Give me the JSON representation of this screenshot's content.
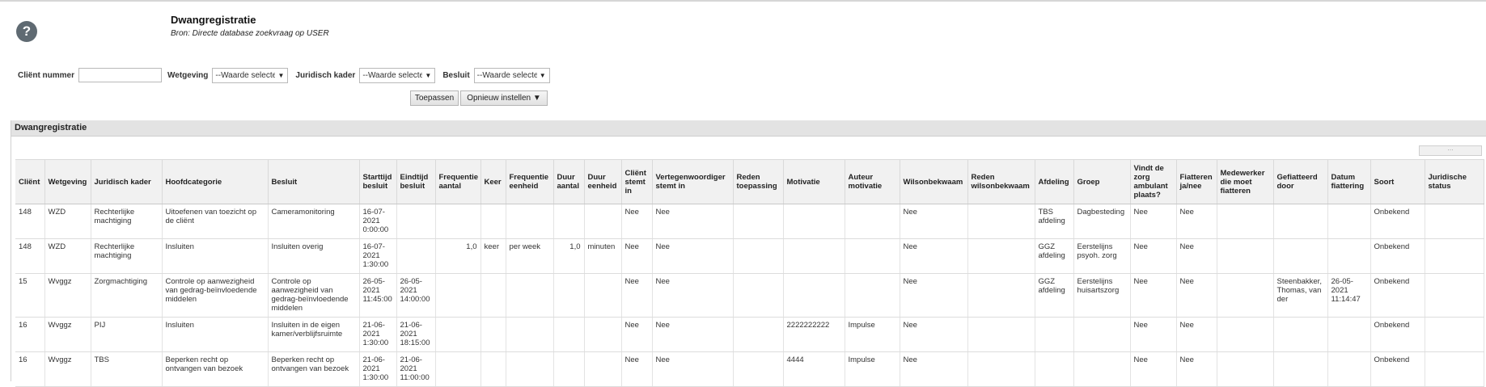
{
  "header": {
    "help_icon": "?",
    "title": "Dwangregistratie",
    "subtitle": "Bron: Directe database zoekvraag op USER"
  },
  "filters": {
    "client_label": "Cliënt nummer",
    "client_value": "",
    "wetgeving_label": "Wetgeving",
    "wetgeving_value": "--Waarde selecteren--",
    "juridisch_label": "Juridisch kader",
    "juridisch_value": "--Waarde selecteren--",
    "besluit_label": "Besluit",
    "besluit_value": "--Waarde selecteren--",
    "apply_label": "Toepassen",
    "reset_label": "Opnieuw instellen ▼"
  },
  "panel": {
    "title": "Dwangregistratie",
    "mini_control": "⋯"
  },
  "table": {
    "columns": [
      "Cliënt",
      "Wetgeving",
      "Juridisch kader",
      "Hoofdcategorie",
      "Besluit",
      "Starttijd besluit",
      "Eindtijd besluit",
      "Frequentie aantal",
      "Keer",
      "Frequentie eenheid",
      "Duur aantal",
      "Duur eenheid",
      "Cliënt stemt in",
      "Vertegenwoordiger stemt in",
      "Reden toepassing",
      "Motivatie",
      "Auteur motivatie",
      "Wilsonbekwaam",
      "Reden wilsonbekwaam",
      "Afdeling",
      "Groep",
      "Vindt de zorg ambulant plaats?",
      "Fiatteren ja/nee",
      "Medewerker die moet fiatteren",
      "Gefiatteerd door",
      "Datum fiattering",
      "Soort",
      "Juridische status"
    ],
    "rows": [
      [
        "148",
        "WZD",
        "Rechterlijke machtiging",
        "Uitoefenen van toezicht op de cliënt",
        "Cameramonitoring",
        "16-07-2021 0:00:00",
        "",
        "",
        "",
        "",
        "",
        "",
        "Nee",
        "Nee",
        "",
        "",
        "",
        "Nee",
        "",
        "TBS afdeling",
        "Dagbesteding",
        "Nee",
        "Nee",
        "",
        "",
        "",
        "Onbekend",
        ""
      ],
      [
        "148",
        "WZD",
        "Rechterlijke machtiging",
        "Insluiten",
        "Insluiten overig",
        "16-07-2021 1:30:00",
        "",
        "1,0",
        "keer",
        "per week",
        "1,0",
        "minuten",
        "Nee",
        "Nee",
        "",
        "",
        "",
        "Nee",
        "",
        "GGZ afdeling",
        "Eerstelijns psyoh. zorg",
        "Nee",
        "Nee",
        "",
        "",
        "",
        "Onbekend",
        ""
      ],
      [
        "15",
        "Wvggz",
        "Zorgmachtiging",
        "Controle op aanwezigheid van gedrag-beïnvloedende middelen",
        "Controle op aanwezigheid van gedrag-beïnvloedende middelen",
        "26-05-2021 11:45:00",
        "26-05-2021 14:00:00",
        "",
        "",
        "",
        "",
        "",
        "Nee",
        "Nee",
        "",
        "",
        "",
        "Nee",
        "",
        "GGZ afdeling",
        "Eerstelijns huisartszorg",
        "Nee",
        "Nee",
        "",
        "Steenbakker, Thomas, van der",
        "26-05-2021 11:14:47",
        "Onbekend",
        ""
      ],
      [
        "16",
        "Wvggz",
        "PIJ",
        "Insluiten",
        "Insluiten in de eigen kamer/verblijfsruimte",
        "21-06-2021 1:30:00",
        "21-06-2021 18:15:00",
        "",
        "",
        "",
        "",
        "",
        "Nee",
        "Nee",
        "",
        "2222222222",
        "Impulse",
        "Nee",
        "",
        "",
        "",
        "Nee",
        "Nee",
        "",
        "",
        "",
        "Onbekend",
        ""
      ],
      [
        "16",
        "Wvggz",
        "TBS",
        "Beperken recht op ontvangen van bezoek",
        "Beperken recht op ontvangen van bezoek",
        "21-06-2021 1:30:00",
        "21-06-2021 11:00:00",
        "",
        "",
        "",
        "",
        "",
        "Nee",
        "Nee",
        "",
        "4444",
        "Impulse",
        "Nee",
        "",
        "",
        "",
        "Nee",
        "Nee",
        "",
        "",
        "",
        "Onbekend",
        ""
      ]
    ]
  },
  "colors": {
    "panel_header_bg": "#e3e3e3",
    "table_header_bg": "#f1f1f1",
    "help_icon_bg": "#5f6a72"
  }
}
